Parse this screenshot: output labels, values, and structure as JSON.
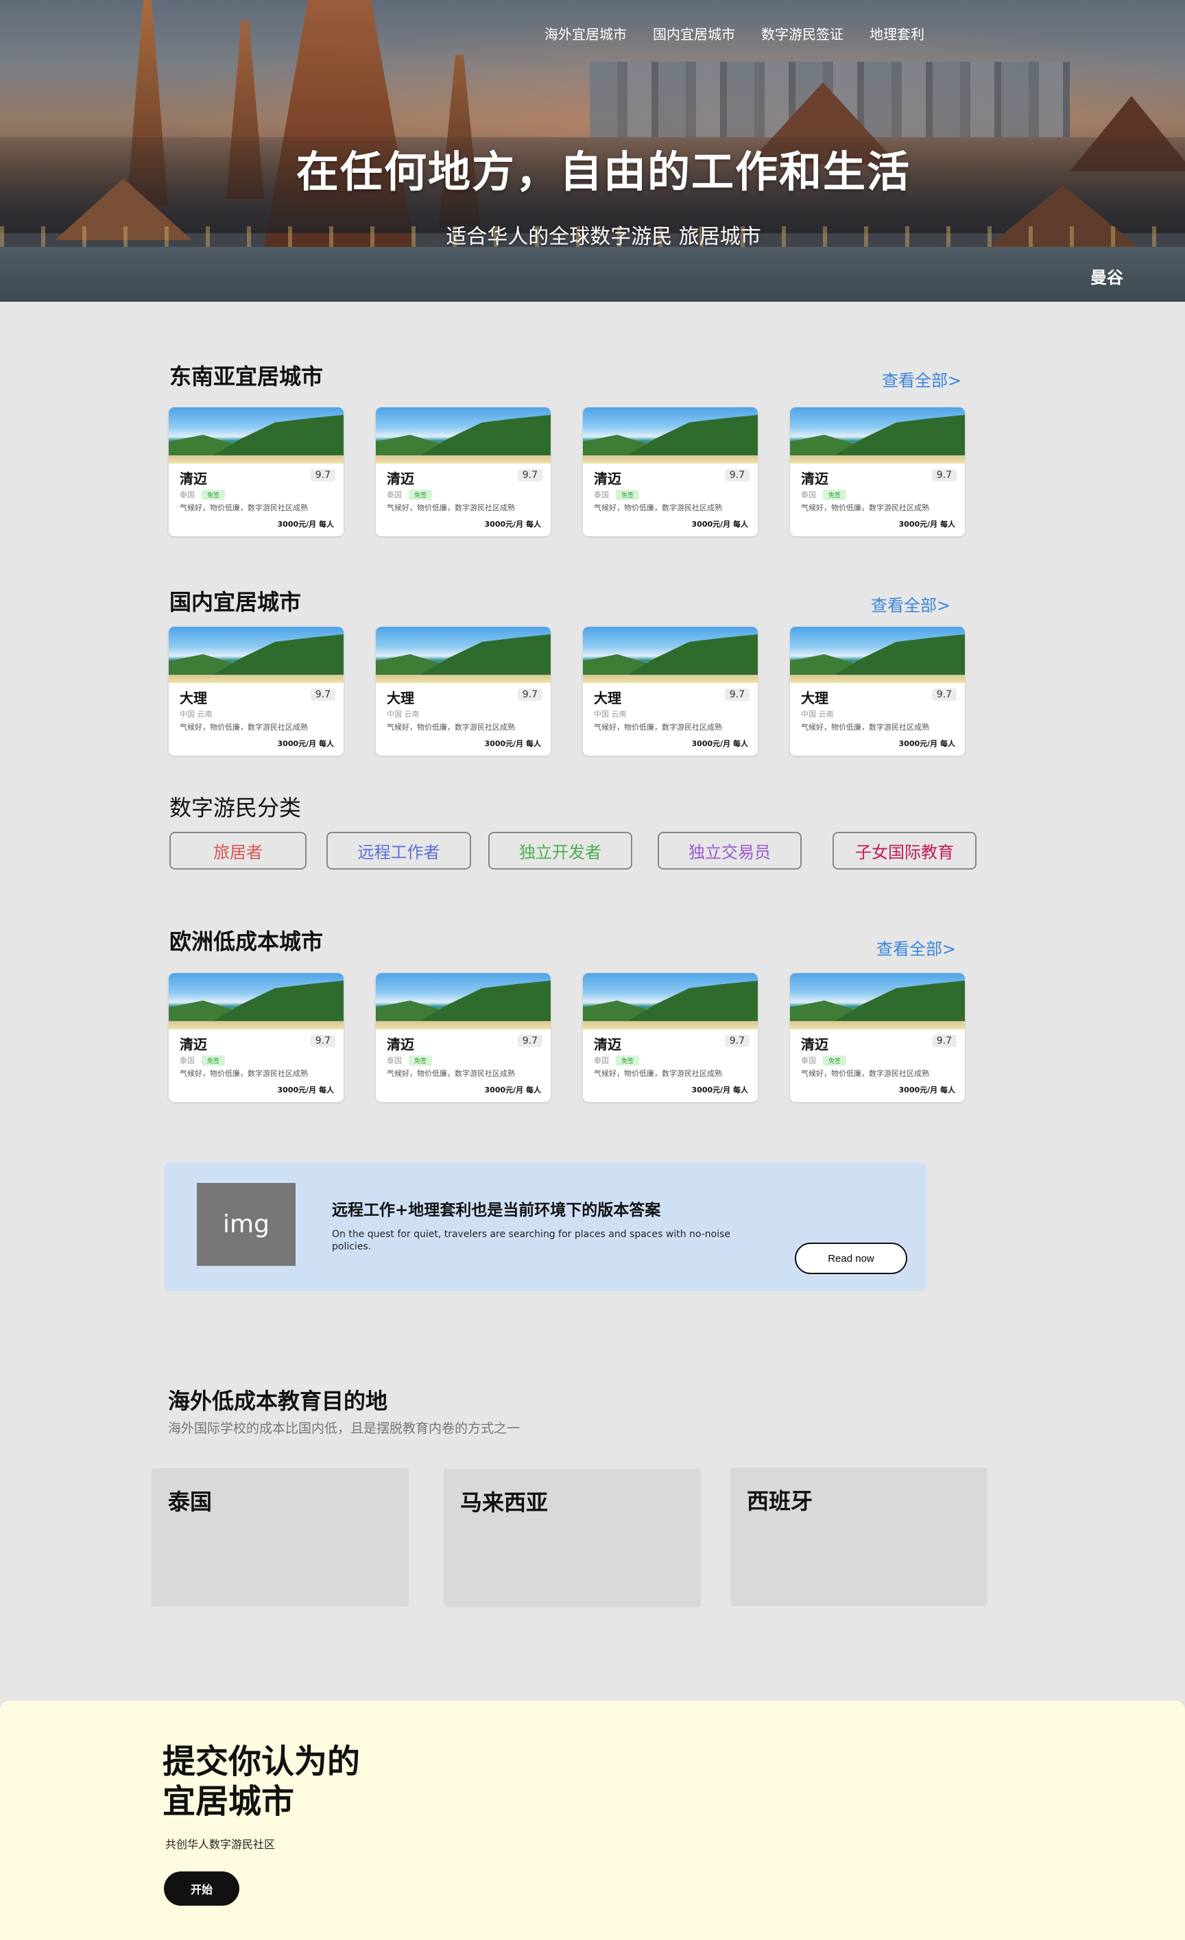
{
  "nav": {
    "items": [
      "海外宜居城市",
      "国内宜居城市",
      "数字游民签证",
      "地理套利"
    ]
  },
  "hero": {
    "title": "在任何地方，自由的工作和生活",
    "subtitle": "适合华人的全球数字游民 旅居城市",
    "location": "曼谷"
  },
  "sections": {
    "sea": {
      "title": "东南亚宜居城市",
      "view_all": "查看全部>"
    },
    "domestic": {
      "title": "国内宜居城市",
      "view_all": "查看全部>"
    },
    "europe": {
      "title": "欧洲低成本城市",
      "view_all": "查看全部>"
    }
  },
  "cards": {
    "sea": [
      {
        "name": "清迈",
        "score": "9.7",
        "country": "泰国",
        "badge": "免签",
        "desc": "气候好，物价低廉，数字游民社区成熟",
        "price": "3000元/月 每人"
      },
      {
        "name": "清迈",
        "score": "9.7",
        "country": "泰国",
        "badge": "免签",
        "desc": "气候好，物价低廉，数字游民社区成熟",
        "price": "3000元/月 每人"
      },
      {
        "name": "清迈",
        "score": "9.7",
        "country": "泰国",
        "badge": "免签",
        "desc": "气候好，物价低廉，数字游民社区成熟",
        "price": "3000元/月 每人"
      },
      {
        "name": "清迈",
        "score": "9.7",
        "country": "泰国",
        "badge": "免签",
        "desc": "气候好，物价低廉，数字游民社区成熟",
        "price": "3000元/月 每人"
      }
    ],
    "domestic": [
      {
        "name": "大理",
        "score": "9.7",
        "country": "中国 云南",
        "badge": "",
        "desc": "气候好，物价低廉，数字游民社区成熟",
        "price": "3000元/月 每人"
      },
      {
        "name": "大理",
        "score": "9.7",
        "country": "中国 云南",
        "badge": "",
        "desc": "气候好，物价低廉，数字游民社区成熟",
        "price": "3000元/月 每人"
      },
      {
        "name": "大理",
        "score": "9.7",
        "country": "中国 云南",
        "badge": "",
        "desc": "气候好，物价低廉，数字游民社区成熟",
        "price": "3000元/月 每人"
      },
      {
        "name": "大理",
        "score": "9.7",
        "country": "中国 云南",
        "badge": "",
        "desc": "气候好，物价低廉，数字游民社区成熟",
        "price": "3000元/月 每人"
      }
    ],
    "europe": [
      {
        "name": "清迈",
        "score": "9.7",
        "country": "泰国",
        "badge": "免签",
        "desc": "气候好，物价低廉，数字游民社区成熟",
        "price": "3000元/月 每人"
      },
      {
        "name": "清迈",
        "score": "9.7",
        "country": "泰国",
        "badge": "免签",
        "desc": "气候好，物价低廉，数字游民社区成熟",
        "price": "3000元/月 每人"
      },
      {
        "name": "清迈",
        "score": "9.7",
        "country": "泰国",
        "badge": "免签",
        "desc": "气候好，物价低廉，数字游民社区成熟",
        "price": "3000元/月 每人"
      },
      {
        "name": "清迈",
        "score": "9.7",
        "country": "泰国",
        "badge": "免签",
        "desc": "气候好，物价低廉，数字游民社区成熟",
        "price": "3000元/月 每人"
      }
    ]
  },
  "categories": {
    "title": "数字游民分类",
    "items": [
      {
        "label": "旅居者",
        "color": "#d9534f"
      },
      {
        "label": "远程工作者",
        "color": "#5b6fd6"
      },
      {
        "label": "独立开发者",
        "color": "#4caf50"
      },
      {
        "label": "独立交易员",
        "color": "#9b59d0"
      },
      {
        "label": "子女国际教育",
        "color": "#c2185b"
      }
    ]
  },
  "promo": {
    "img_label": "img",
    "title": "远程工作+地理套利也是当前环境下的版本答案",
    "text": "On the quest for quiet, travelers are searching for places and spaces with no-noise policies.",
    "button": "Read now"
  },
  "education": {
    "title": "海外低成本教育目的地",
    "subtitle": "海外国际学校的成本比国内低，且是摆脱教育内卷的方式之一",
    "countries": [
      "泰国",
      "马来西亚",
      "西班牙"
    ]
  },
  "cta": {
    "title": "提交你认为的宜居城市",
    "subtitle": "共创华人数字游民社区",
    "button": "开始"
  }
}
